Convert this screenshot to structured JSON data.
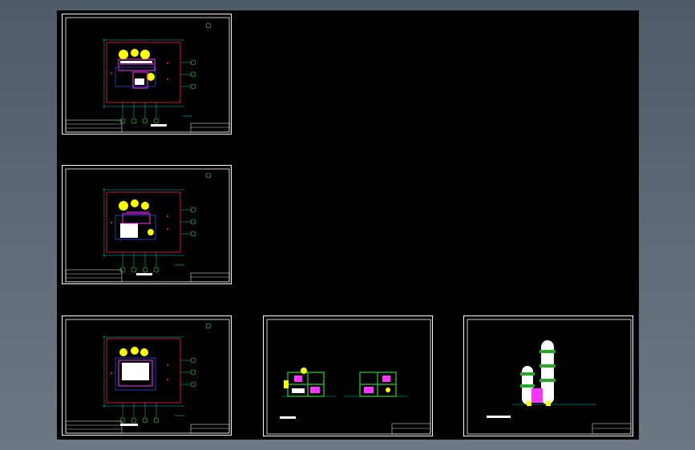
{
  "app": {
    "background_top": "#4f5a68",
    "background_bottom": "#6c7784",
    "model_space_color": "#000000"
  },
  "sheets": [
    {
      "id": "sheet-1",
      "kind": "floor-plan",
      "title": ""
    },
    {
      "id": "sheet-2",
      "kind": "floor-plan",
      "title": ""
    },
    {
      "id": "sheet-3",
      "kind": "floor-plan",
      "title": ""
    },
    {
      "id": "sheet-4",
      "kind": "sections",
      "title": ""
    },
    {
      "id": "sheet-5",
      "kind": "elevation",
      "title": ""
    }
  ],
  "colors": {
    "frame": "#ffffff",
    "building_outline": "#d2143a",
    "grid_lines": "#00c8c8",
    "grid_bubbles": "#33dd33",
    "equipment": "#ffff00",
    "piping": "#ff33ff",
    "structure": "#3355ff",
    "tower_green": "#22aa22"
  }
}
